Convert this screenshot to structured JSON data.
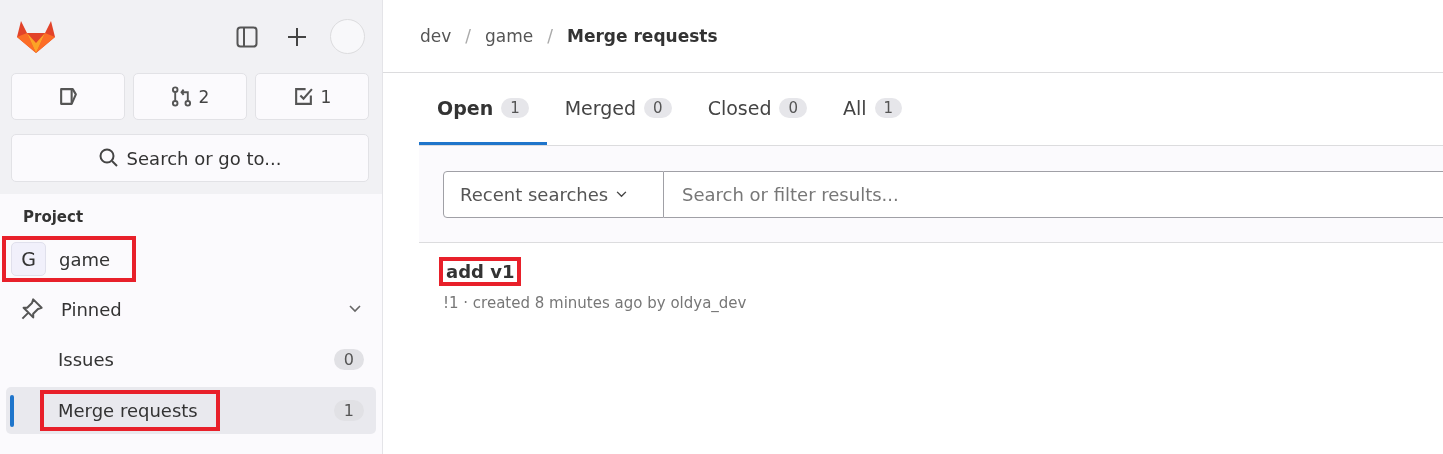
{
  "sidebar": {
    "quick_buttons": [
      {
        "kind": "issues"
      },
      {
        "kind": "merge",
        "count": "2"
      },
      {
        "kind": "todo",
        "count": "1"
      }
    ],
    "search": {
      "placeholder": "Search or go to..."
    },
    "section_title": "Project",
    "project": {
      "avatar": "G",
      "name": "game",
      "highlighted": true
    },
    "pinned": {
      "label": "Pinned",
      "expanded": true
    },
    "items": [
      {
        "label": "Issues",
        "count": "0",
        "selected": false,
        "highlighted": false
      },
      {
        "label": "Merge requests",
        "count": "1",
        "selected": true,
        "highlighted": true
      }
    ]
  },
  "breadcrumb": [
    {
      "label": "dev",
      "current": false
    },
    {
      "separator": "/",
      "label": "game",
      "current": false
    },
    {
      "separator": "/",
      "label": "Merge requests",
      "current": true
    }
  ],
  "tabs": [
    {
      "label": "Open",
      "count": "1",
      "selected": true
    },
    {
      "label": "Merged",
      "count": "0",
      "selected": false
    },
    {
      "label": "Closed",
      "count": "0",
      "selected": false
    },
    {
      "label": "All",
      "count": "1",
      "selected": false
    }
  ],
  "filter": {
    "dropdown": "Recent searches",
    "placeholder": "Search or filter results..."
  },
  "merge_requests": [
    {
      "title": "add v1",
      "meta": "!1 · created 8 minutes ago by oldya_dev",
      "highlighted": true
    }
  ]
}
